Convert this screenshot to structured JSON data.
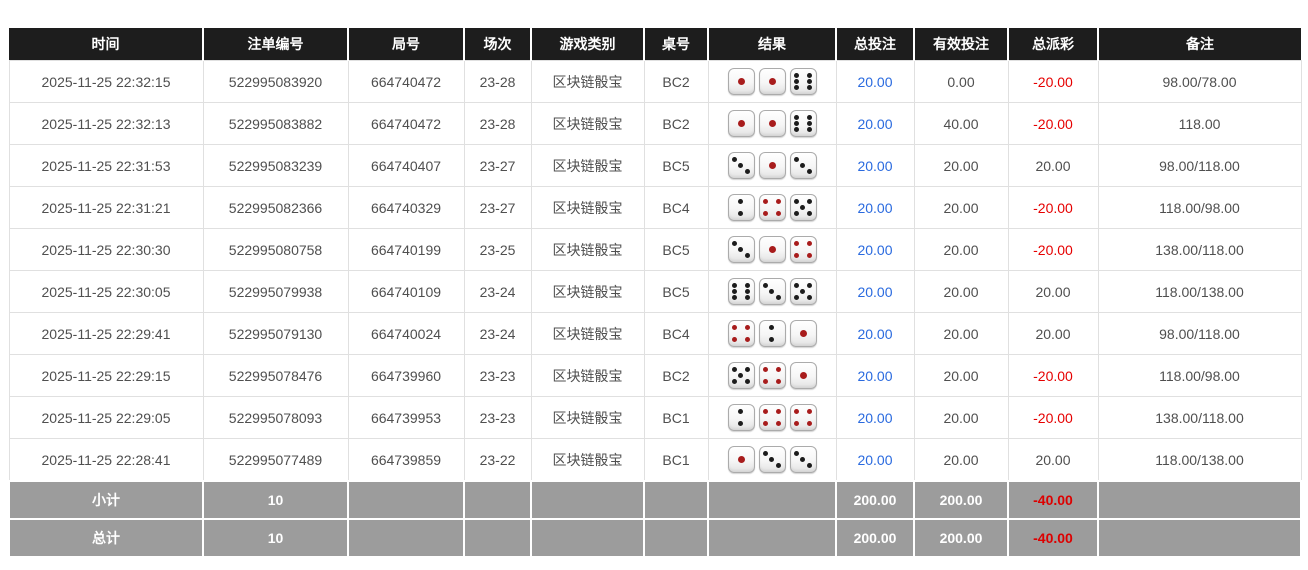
{
  "colors": {
    "header_bg": "#1d1d1d",
    "accent_blue": "#2a6adf",
    "negative_red": "#e60000",
    "summary_bg": "#9c9c9c"
  },
  "dice": {
    "red_faces": [
      1,
      4
    ]
  },
  "table": {
    "columns": [
      {
        "key": "time",
        "label": "时间"
      },
      {
        "key": "bet_id",
        "label": "注单编号"
      },
      {
        "key": "round_id",
        "label": "局号"
      },
      {
        "key": "session",
        "label": "场次"
      },
      {
        "key": "game_type",
        "label": "游戏类别"
      },
      {
        "key": "table_no",
        "label": "桌号"
      },
      {
        "key": "result",
        "label": "结果"
      },
      {
        "key": "total_bet",
        "label": "总投注"
      },
      {
        "key": "valid_bet",
        "label": "有效投注"
      },
      {
        "key": "payout",
        "label": "总派彩"
      },
      {
        "key": "remark",
        "label": "备注"
      }
    ],
    "rows": [
      {
        "time": "2025-11-25 22:32:15",
        "bet_id": "522995083920",
        "round_id": "664740472",
        "session": "23-28",
        "game_type": "区块链骰宝",
        "table_no": "BC2",
        "dice": [
          1,
          1,
          6
        ],
        "total_bet": "20.00",
        "valid_bet": "0.00",
        "payout": "-20.00",
        "remark": "98.00/78.00"
      },
      {
        "time": "2025-11-25 22:32:13",
        "bet_id": "522995083882",
        "round_id": "664740472",
        "session": "23-28",
        "game_type": "区块链骰宝",
        "table_no": "BC2",
        "dice": [
          1,
          1,
          6
        ],
        "total_bet": "20.00",
        "valid_bet": "40.00",
        "payout": "-20.00",
        "remark": "118.00"
      },
      {
        "time": "2025-11-25 22:31:53",
        "bet_id": "522995083239",
        "round_id": "664740407",
        "session": "23-27",
        "game_type": "区块链骰宝",
        "table_no": "BC5",
        "dice": [
          3,
          1,
          3
        ],
        "total_bet": "20.00",
        "valid_bet": "20.00",
        "payout": "20.00",
        "remark": "98.00/118.00"
      },
      {
        "time": "2025-11-25 22:31:21",
        "bet_id": "522995082366",
        "round_id": "664740329",
        "session": "23-27",
        "game_type": "区块链骰宝",
        "table_no": "BC4",
        "dice": [
          2,
          4,
          5
        ],
        "total_bet": "20.00",
        "valid_bet": "20.00",
        "payout": "-20.00",
        "remark": "118.00/98.00"
      },
      {
        "time": "2025-11-25 22:30:30",
        "bet_id": "522995080758",
        "round_id": "664740199",
        "session": "23-25",
        "game_type": "区块链骰宝",
        "table_no": "BC5",
        "dice": [
          3,
          1,
          4
        ],
        "total_bet": "20.00",
        "valid_bet": "20.00",
        "payout": "-20.00",
        "remark": "138.00/118.00"
      },
      {
        "time": "2025-11-25 22:30:05",
        "bet_id": "522995079938",
        "round_id": "664740109",
        "session": "23-24",
        "game_type": "区块链骰宝",
        "table_no": "BC5",
        "dice": [
          6,
          3,
          5
        ],
        "total_bet": "20.00",
        "valid_bet": "20.00",
        "payout": "20.00",
        "remark": "118.00/138.00"
      },
      {
        "time": "2025-11-25 22:29:41",
        "bet_id": "522995079130",
        "round_id": "664740024",
        "session": "23-24",
        "game_type": "区块链骰宝",
        "table_no": "BC4",
        "dice": [
          4,
          2,
          1
        ],
        "total_bet": "20.00",
        "valid_bet": "20.00",
        "payout": "20.00",
        "remark": "98.00/118.00"
      },
      {
        "time": "2025-11-25 22:29:15",
        "bet_id": "522995078476",
        "round_id": "664739960",
        "session": "23-23",
        "game_type": "区块链骰宝",
        "table_no": "BC2",
        "dice": [
          5,
          4,
          1
        ],
        "total_bet": "20.00",
        "valid_bet": "20.00",
        "payout": "-20.00",
        "remark": "118.00/98.00"
      },
      {
        "time": "2025-11-25 22:29:05",
        "bet_id": "522995078093",
        "round_id": "664739953",
        "session": "23-23",
        "game_type": "区块链骰宝",
        "table_no": "BC1",
        "dice": [
          2,
          4,
          4
        ],
        "total_bet": "20.00",
        "valid_bet": "20.00",
        "payout": "-20.00",
        "remark": "138.00/118.00"
      },
      {
        "time": "2025-11-25 22:28:41",
        "bet_id": "522995077489",
        "round_id": "664739859",
        "session": "23-22",
        "game_type": "区块链骰宝",
        "table_no": "BC1",
        "dice": [
          1,
          3,
          3
        ],
        "total_bet": "20.00",
        "valid_bet": "20.00",
        "payout": "20.00",
        "remark": "118.00/138.00"
      }
    ],
    "footer": [
      {
        "label": "小计",
        "count": "10",
        "total_bet": "200.00",
        "valid_bet": "200.00",
        "payout": "-40.00"
      },
      {
        "label": "总计",
        "count": "10",
        "total_bet": "200.00",
        "valid_bet": "200.00",
        "payout": "-40.00"
      }
    ]
  }
}
